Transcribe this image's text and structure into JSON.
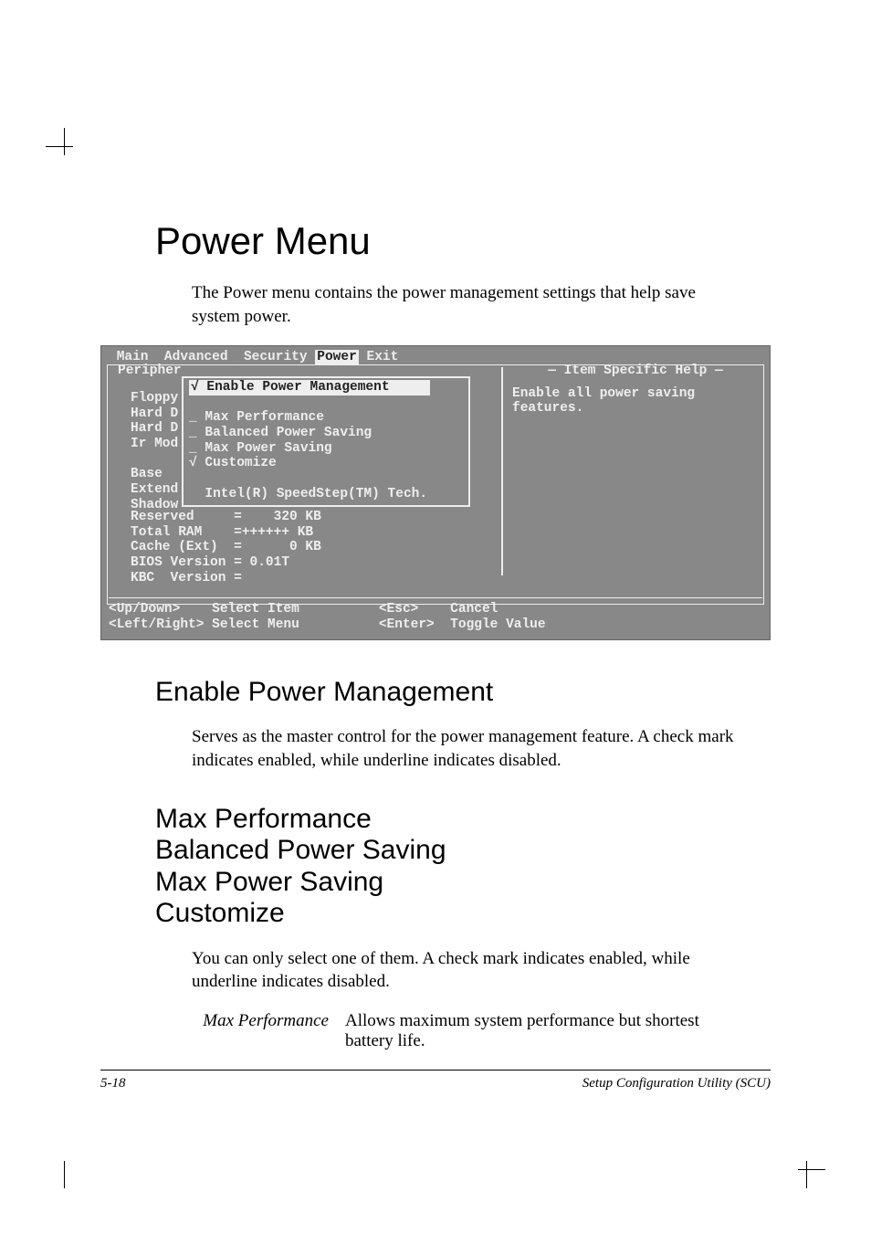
{
  "title": "Power Menu",
  "intro": "The Power menu contains the power management settings that help save system power.",
  "bios": {
    "menus": {
      "m1": "Main",
      "m2": "Advanced",
      "m3": "Security",
      "m4": "Power",
      "m5": "Exit"
    },
    "peripher": "Peripher",
    "left_items": "Floppy\nHard D\nHard D\nIr Mod\n\nBase\nExtend\nShadow",
    "popup": {
      "hl": "√ Enable Power Management",
      "rows": "\n_ Max Performance\n_ Balanced Power Saving\n_ Max Power Saving\n√ Customize\n\n  Intel(R) SpeedStep(TM) Tech."
    },
    "mem": "Reserved     =    320 KB\nTotal RAM    =++++++ KB\nCache (Ext)  =      0 KB\nBIOS Version = 0.01T\nKBC  Version =",
    "help_label": "Item Specific Help",
    "help_text": "Enable all power saving\nfeatures.",
    "footer": "<Up/Down>    Select Item          <Esc>    Cancel\n<Left/Right> Select Menu          <Enter>  Toggle Value"
  },
  "section1_title": "Enable Power Management",
  "section1_body": "Serves as the master control for the power management feature. A check mark indicates enabled, while underline indicates disabled.",
  "section2_titles": {
    "a": "Max Performance",
    "b": "Balanced Power Saving",
    "c": "Max Power Saving",
    "d": "Customize"
  },
  "section2_body": "You can only select one of them. A check mark indicates enabled, while underline indicates disabled.",
  "def": {
    "term": "Max Performance",
    "desc": "Allows maximum system performance but shortest battery life."
  },
  "footer": {
    "page": "5-18",
    "label": "Setup Configuration Utility (SCU)"
  }
}
